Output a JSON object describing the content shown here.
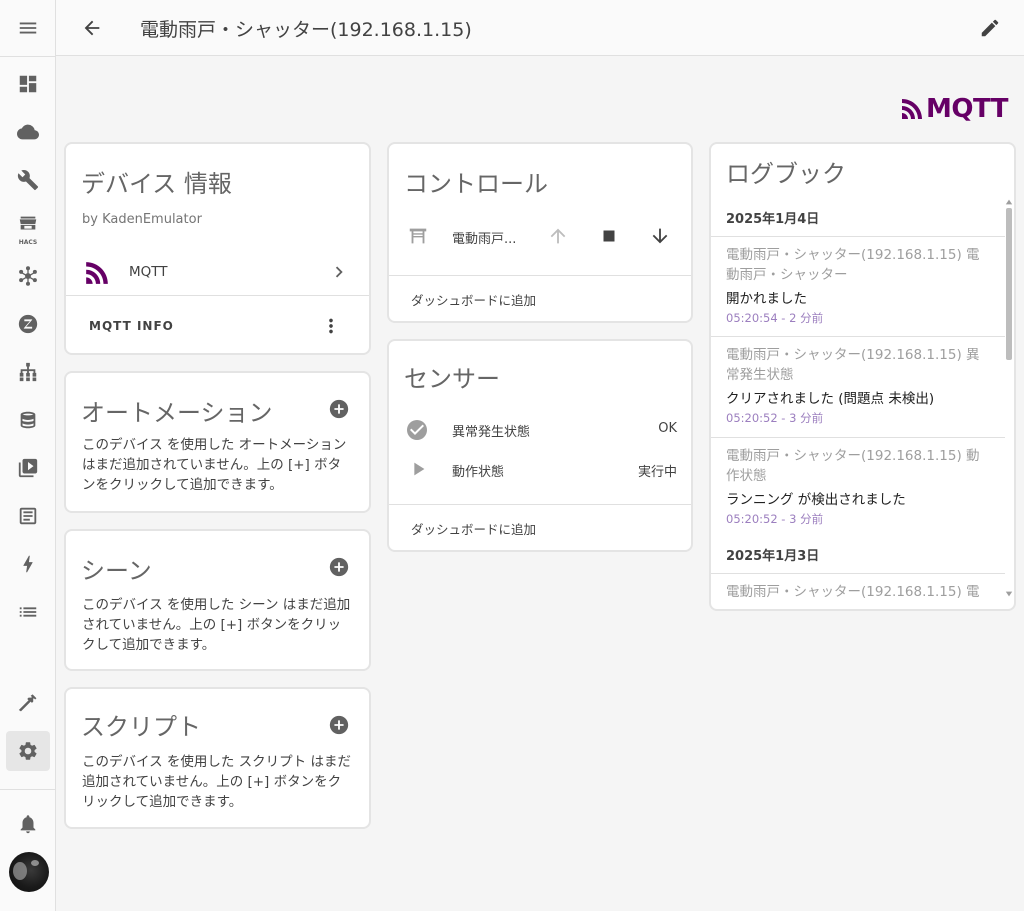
{
  "header": {
    "title": "電動雨戸・シャッター(192.168.1.15)"
  },
  "sidebar": {
    "items": [
      {
        "icon": "menu-icon"
      },
      {
        "icon": "dashboard-icon"
      },
      {
        "icon": "cloud-icon"
      },
      {
        "icon": "wrench-icon"
      },
      {
        "icon": "hacs-store-icon",
        "label": "HACS"
      },
      {
        "icon": "zigbee-icon"
      },
      {
        "icon": "zwave-icon"
      },
      {
        "icon": "network-icon"
      },
      {
        "icon": "database-icon"
      },
      {
        "icon": "media-icon"
      },
      {
        "icon": "logbook-icon"
      },
      {
        "icon": "lightning-icon"
      },
      {
        "icon": "list-icon"
      },
      {
        "icon": "hammer-icon"
      },
      {
        "icon": "gear-icon"
      },
      {
        "icon": "bell-icon"
      }
    ]
  },
  "brand": {
    "logo_text": "MQTT",
    "color": "#660066"
  },
  "device_info": {
    "title": "デバイス 情報",
    "by": "by KadenEmulator",
    "integration": "MQTT",
    "info_button": "MQTT INFO"
  },
  "automation": {
    "title": "オートメーション",
    "text": "このデバイス を使用した オートメーション はまだ追加されていません。上の [+] ボタンをクリックして追加できます。"
  },
  "scene": {
    "title": "シーン",
    "text": "このデバイス を使用した シーン はまだ追加されていません。上の [+] ボタンをクリックして追加できます。"
  },
  "script": {
    "title": "スクリプト",
    "text": "このデバイス を使用した スクリプト はまだ追加されていません。上の [+] ボタンをクリックして追加できます。"
  },
  "control": {
    "title": "コントロール",
    "entity_name": "電動雨戸...",
    "add_dashboard": "ダッシュボードに追加"
  },
  "sensor": {
    "title": "センサー",
    "rows": [
      {
        "name": "異常発生状態",
        "value": "OK",
        "icon": "check-circle-icon"
      },
      {
        "name": "動作状態",
        "value": "実行中",
        "icon": "play-icon"
      }
    ],
    "add_dashboard": "ダッシュボードに追加"
  },
  "logbook": {
    "title": "ログブック",
    "dates": [
      "2025年1月4日",
      "2025年1月3日"
    ],
    "entries": [
      {
        "name": "電動雨戸・シャッター(192.168.1.15) 電動雨戸・シャッター",
        "message": "開かれました",
        "time": "05:20:54 - 2 分前"
      },
      {
        "name": "電動雨戸・シャッター(192.168.1.15) 異常発生状態",
        "message": "クリアされました (問題点 未検出)",
        "time": "05:20:52 - 3 分前"
      },
      {
        "name": "電動雨戸・シャッター(192.168.1.15) 動作状態",
        "message": "ランニング が検出されました",
        "time": "05:20:52 - 3 分前"
      },
      {
        "name": "電動雨戸・シャッター(192.168.1.15) 電",
        "message": "",
        "time": ""
      }
    ]
  }
}
